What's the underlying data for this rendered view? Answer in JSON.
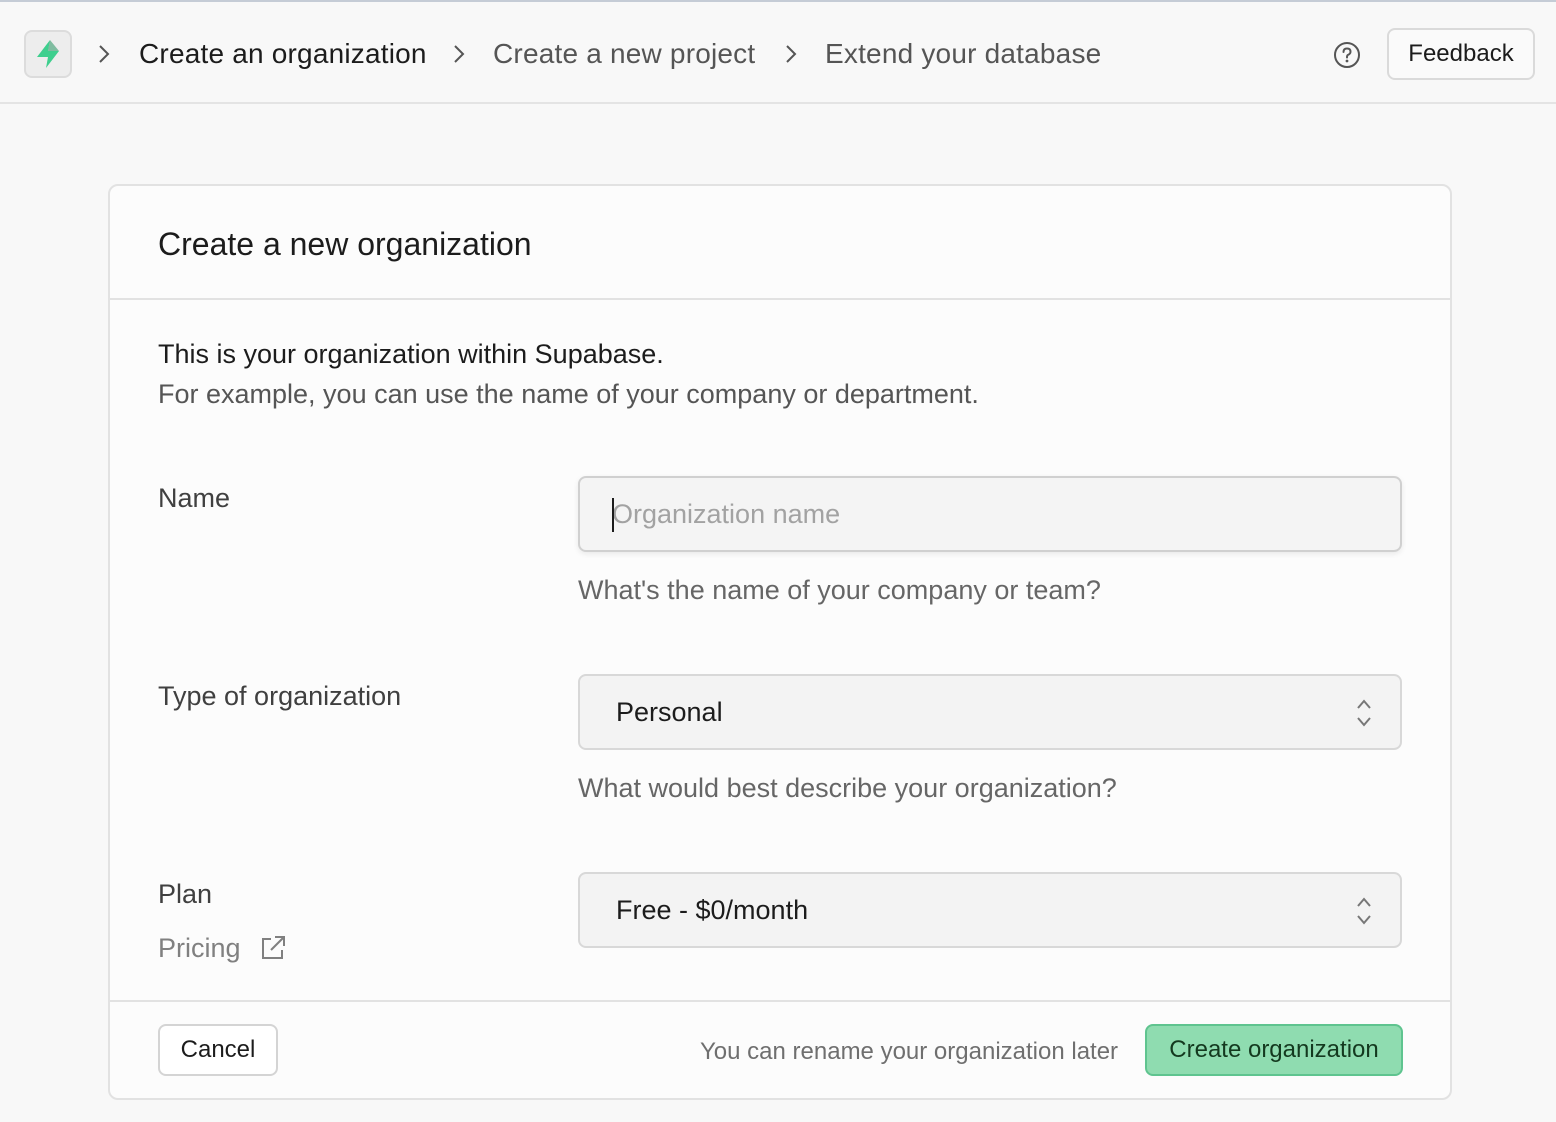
{
  "colors": {
    "brand_green": "#3ecf8e",
    "primary_button_bg": "#8fdcb0",
    "primary_button_border": "#5fc48f",
    "page_bg": "#f8f8f8"
  },
  "topbar": {
    "logo_icon": "supabase-bolt-icon",
    "breadcrumbs": [
      {
        "label": "Create an organization"
      },
      {
        "label": "Create a new project"
      },
      {
        "label": "Extend your database"
      }
    ],
    "separator_icon": "chevron-right-icon",
    "help_icon": "question-circle-icon",
    "feedback_label": "Feedback"
  },
  "card": {
    "title": "Create a new organization",
    "intro_line1": "This is your organization within Supabase.",
    "intro_line2": "For example, you can use the name of your company or department.",
    "name_field": {
      "label": "Name",
      "placeholder": "Organization name",
      "value": "",
      "help": "What's the name of your company or team?"
    },
    "type_field": {
      "label": "Type of organization",
      "selected": "Personal",
      "help": "What would best describe your organization?"
    },
    "plan_field": {
      "label": "Plan",
      "selected": "Free - $0/month",
      "pricing_link": "Pricing",
      "pricing_icon": "external-link-icon"
    },
    "footer": {
      "cancel_label": "Cancel",
      "note": "You can rename your organization later",
      "create_label": "Create organization"
    }
  }
}
